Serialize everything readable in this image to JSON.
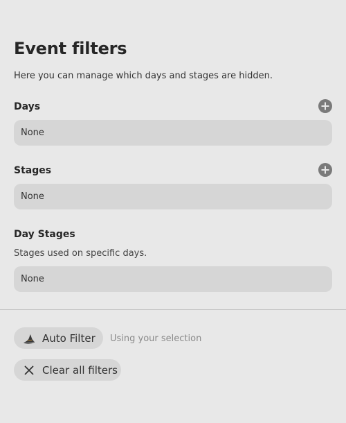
{
  "page": {
    "title": "Event filters",
    "subtitle": "Here you can manage which days and stages are hidden."
  },
  "days": {
    "label": "Days",
    "add_icon": "plus-circle-icon",
    "value": "None"
  },
  "stages": {
    "label": "Stages",
    "add_icon": "plus-circle-icon",
    "value": "None"
  },
  "day_stages": {
    "label": "Day Stages",
    "description": "Stages used on specific days.",
    "value": "None"
  },
  "actions": {
    "auto_filter_label": "Auto Filter",
    "auto_filter_icon": "wizard-hat-icon",
    "auto_filter_hint": "Using your selection",
    "clear_label": "Clear all filters",
    "clear_icon": "close-icon"
  },
  "colors": {
    "background": "#e8e8e8",
    "field": "#d6d6d6",
    "icon": "#7a7a7a"
  }
}
